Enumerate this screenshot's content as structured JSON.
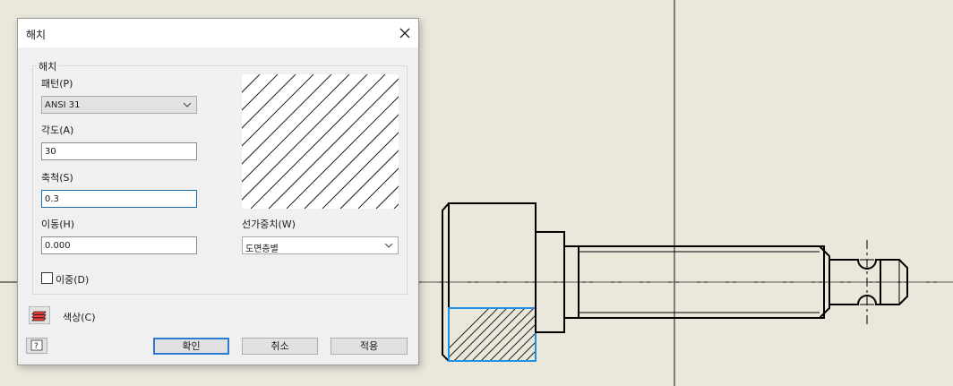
{
  "dialog": {
    "title": "해치",
    "group_label": "해치",
    "pattern": {
      "label": "패턴(P)",
      "value": "ANSI 31"
    },
    "angle": {
      "label": "각도(A)",
      "value": "30"
    },
    "scale": {
      "label": "축척(S)",
      "value": "0.3"
    },
    "offset": {
      "label": "이동(H)",
      "value": "0.000"
    },
    "lineweight": {
      "label": "선가중치(W)",
      "value": "도면층별"
    },
    "double": {
      "label": "이중(D)",
      "checked": false
    },
    "color": {
      "label": "색상(C)"
    },
    "buttons": {
      "ok": "확인",
      "cancel": "취소",
      "apply": "적용"
    }
  },
  "icons": {
    "close": "close-icon",
    "dropdown": "chevron-down-icon",
    "color": "color-layers-icon",
    "help": "help-icon"
  },
  "colors": {
    "canvas": "#eae8db",
    "selection": "#1e90e6",
    "focus_border": "#1f6fa8",
    "default_button_border": "#2b7bd0"
  }
}
